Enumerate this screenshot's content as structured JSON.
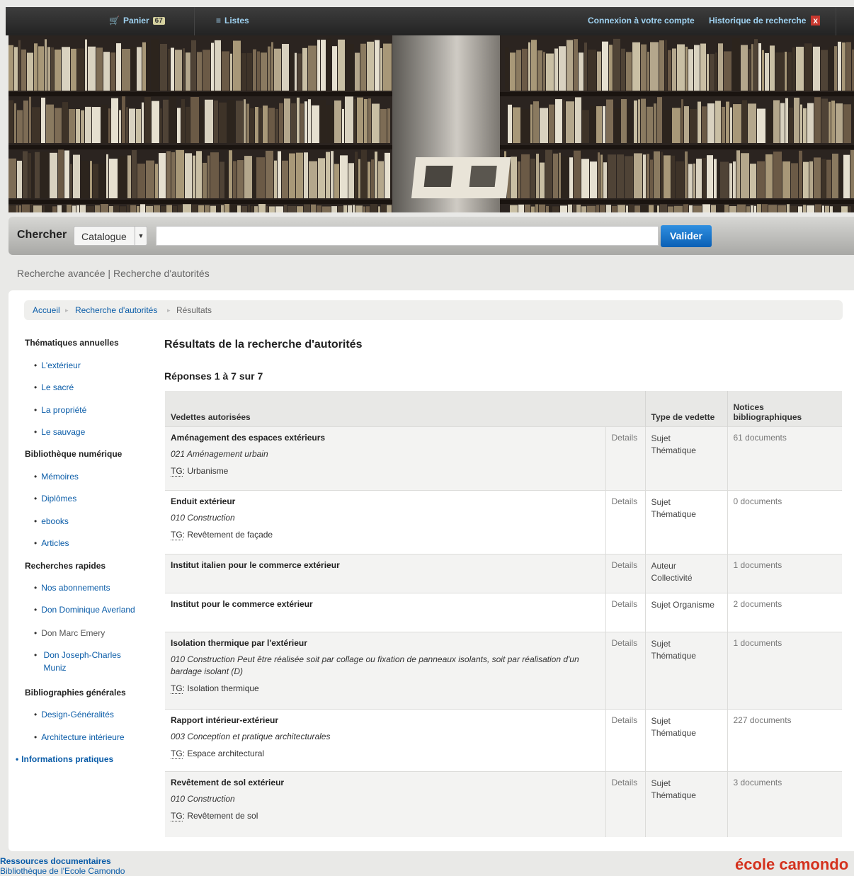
{
  "topbar": {
    "cart_label": "Panier",
    "cart_count": "67",
    "lists_label": "Listes",
    "login_label": "Connexion à votre compte",
    "history_label": "Historique de recherche",
    "history_clear": "x"
  },
  "search": {
    "label": "Chercher",
    "scope": "Catalogue",
    "value": "",
    "submit": "Valider"
  },
  "links": {
    "advanced": "Recherche avancée",
    "separator": "|",
    "authorities": "Recherche d'autorités"
  },
  "breadcrumb": {
    "home": "Accueil",
    "auth": "Recherche d'autorités",
    "current": "Résultats"
  },
  "sidebar": {
    "h1": "Thématiques annuelles",
    "h1_items": [
      "L'extérieur",
      "Le sacré",
      "La propriété",
      "Le sauvage"
    ],
    "h2": "Bibliothèque numérique",
    "h2_items": [
      "Mémoires",
      "Diplômes",
      "ebooks",
      "Articles"
    ],
    "h3": "Recherches rapides",
    "h3_items": [
      "Nos abonnements",
      "Don Dominique Averland",
      "Don Marc Emery",
      "Don Joseph-Charles",
      "Muniz"
    ],
    "h4": "Bibliographies générales",
    "h4_items": [
      "Design-Généralités",
      "Architecture intérieure"
    ],
    "info": "Informations pratiques"
  },
  "results": {
    "title": "Résultats de la recherche d'autorités",
    "count": "Réponses 1 à 7 sur 7",
    "headers": {
      "vedettes": "Vedettes autorisées",
      "type": "Type de vedette",
      "notices_1": "Notices",
      "notices_2": "bibliographiques"
    },
    "details_label": "Details",
    "tg_label": "TG",
    "rows": [
      {
        "heading": "Aménagement des espaces extérieurs",
        "note": "021 Aménagement urbain",
        "tg": ": Urbanisme",
        "type1": "Sujet",
        "type2": "Thématique",
        "notices": "61 documents"
      },
      {
        "heading": "Enduit extérieur",
        "note": "010 Construction",
        "tg": ": Revêtement de façade",
        "type1": "Sujet",
        "type2": "Thématique",
        "notices": "0 documents"
      },
      {
        "heading": "Institut italien pour le commerce extérieur",
        "note": "",
        "tg": "",
        "type1": "Auteur",
        "type2": "Collectivité",
        "notices": "1 documents"
      },
      {
        "heading": "Institut pour le commerce extérieur",
        "note": "",
        "tg": "",
        "type1": "Sujet Organisme",
        "type2": "",
        "notices": "2 documents"
      },
      {
        "heading": "Isolation thermique par l'extérieur",
        "note": "010 Construction Peut être réalisée soit par collage ou fixation de panneaux isolants, soit par réalisation d'un bardage isolant (D)",
        "tg": ": Isolation thermique",
        "type1": "Sujet",
        "type2": "Thématique",
        "notices": "1 documents"
      },
      {
        "heading": "Rapport intérieur-extérieur",
        "note": "003 Conception et pratique architecturales",
        "tg": ": Espace architectural",
        "type1": "Sujet",
        "type2": "Thématique",
        "notices": "227 documents"
      },
      {
        "heading": "Revêtement de sol extérieur",
        "note": "010 Construction",
        "tg": ": Revêtement de sol",
        "type1": "Sujet",
        "type2": "Thématique",
        "notices": "3 documents"
      }
    ]
  },
  "footer": {
    "line1": "Ressources documentaires",
    "line2": "Bibliothèque de l'Ecole Camondo",
    "logo": "école camondo"
  },
  "colors": {
    "link": "#0a5ca8",
    "button": "#0a5fb5",
    "logo": "#d4321e"
  }
}
